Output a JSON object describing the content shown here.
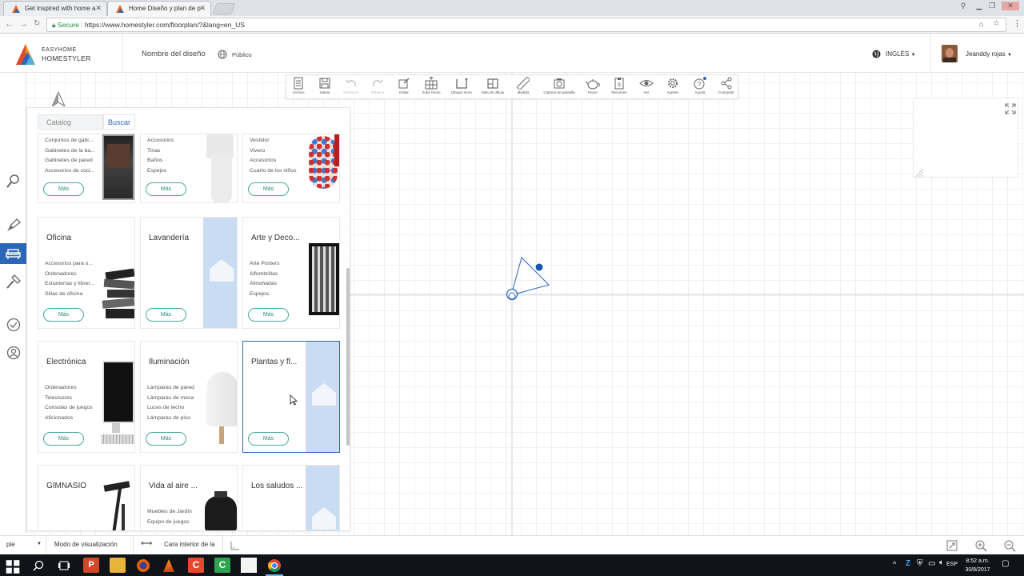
{
  "browser": {
    "tabs": [
      {
        "title": "Get inspired with home a",
        "active": false
      },
      {
        "title": "Home Diseño y plan de p",
        "active": true
      }
    ],
    "secure_label": "Secure",
    "url": "https://www.homestyler.com/floorplan/?&lang=en_US"
  },
  "header": {
    "logo_line1": "EASYHOME",
    "logo_line2": "HOMESTYLER",
    "design_name": "Nombre del diseño",
    "visibility": "Público",
    "language": "INGLÉS",
    "username": "Jeanddy rojas"
  },
  "toolbar": {
    "items": [
      {
        "label": "Archivo",
        "icon": "file-icon",
        "enabled": true
      },
      {
        "label": "Salvar",
        "icon": "save-icon",
        "enabled": true
      },
      {
        "label": "Deshacer",
        "icon": "undo-icon",
        "enabled": false
      },
      {
        "label": "Rehacer",
        "icon": "redo-icon",
        "enabled": false
      },
      {
        "label": "Editar",
        "icon": "edit-icon",
        "enabled": true
      },
      {
        "label": "Subir fondo",
        "icon": "upload-background-icon",
        "enabled": true
      },
      {
        "label": "Dibujar muro",
        "icon": "draw-wall-icon",
        "enabled": true
      },
      {
        "label": "Sala de dibujo",
        "icon": "draw-room-icon",
        "enabled": true
      },
      {
        "label": "Medida",
        "icon": "ruler-icon",
        "enabled": true
      },
      {
        "label": "Captura de pantalla",
        "icon": "camera-icon",
        "enabled": true
      },
      {
        "label": "Hacer",
        "icon": "teapot-icon",
        "enabled": true
      },
      {
        "label": "Resumen",
        "icon": "clipboard-icon",
        "enabled": true
      },
      {
        "label": "Ver",
        "icon": "eye-icon",
        "enabled": true
      },
      {
        "label": "Ajustes",
        "icon": "gear-icon",
        "enabled": true
      },
      {
        "label": "Ayuda",
        "icon": "help-icon",
        "enabled": true
      },
      {
        "label": "Compartir",
        "icon": "share-icon",
        "enabled": true
      }
    ]
  },
  "catalog": {
    "tab_catalog": "Catalog",
    "tab_search": "Buscar",
    "more_label": "Más",
    "cards": [
      {
        "title": "",
        "items": [
          "Conjuntos de gabi...",
          "Gabinetes de la ba...",
          "Gabinetes de pared",
          "Accesorios de coci..."
        ],
        "image": "cabinet"
      },
      {
        "title": "",
        "items": [
          "Accesorios",
          "Tinas",
          "Baños",
          "Espejos"
        ],
        "image": "toilet"
      },
      {
        "title": "",
        "items": [
          "Vestidor",
          "Vivero",
          "Accesorios",
          "Cuarto de los niños"
        ],
        "image": "chair"
      },
      {
        "title": "Oficina",
        "items": [
          "Accesorios para o...",
          "Ordenadores",
          "Estanterías y librer...",
          "Sillas de oficina"
        ],
        "image": "books"
      },
      {
        "title": "Lavandería",
        "items": [],
        "image": "placeholder"
      },
      {
        "title": "Arte y Deco...",
        "items": [
          "Arte Posters",
          "Alfombrillas",
          "Almohadas",
          "Espejos"
        ],
        "image": "frame"
      },
      {
        "title": "Electrónica",
        "items": [
          "Ordenadores",
          "Televisores",
          "Consolas de juegos",
          "Aficionados"
        ],
        "image": "monitor"
      },
      {
        "title": "Iluminación",
        "items": [
          "Lámparas de pared",
          "Lámparas de mesa",
          "Luces de techo",
          "Lámparas de piso"
        ],
        "image": "lamp"
      },
      {
        "title": "Plantas y fl...",
        "items": [],
        "image": "placeholder",
        "selected": true
      },
      {
        "title": "GIMNASIO",
        "items": [],
        "image": "treadmill"
      },
      {
        "title": "Vida al aire ...",
        "items": [
          "Muebles de Jardín",
          "Equipo de juegos"
        ],
        "image": "grill"
      },
      {
        "title": "Los saludos ...",
        "items": [],
        "image": "placeholder"
      }
    ]
  },
  "bottombar": {
    "unit": "pie",
    "view_mode": "Modo de visualización",
    "measure": "Cara interior de la"
  },
  "taskbar": {
    "language": "ESP",
    "time": "8:52 a.m.",
    "date": "30/8/2017"
  },
  "colors": {
    "accent": "#2c67b7",
    "teal": "#46a99a",
    "placeholder": "#c9dcf2"
  }
}
